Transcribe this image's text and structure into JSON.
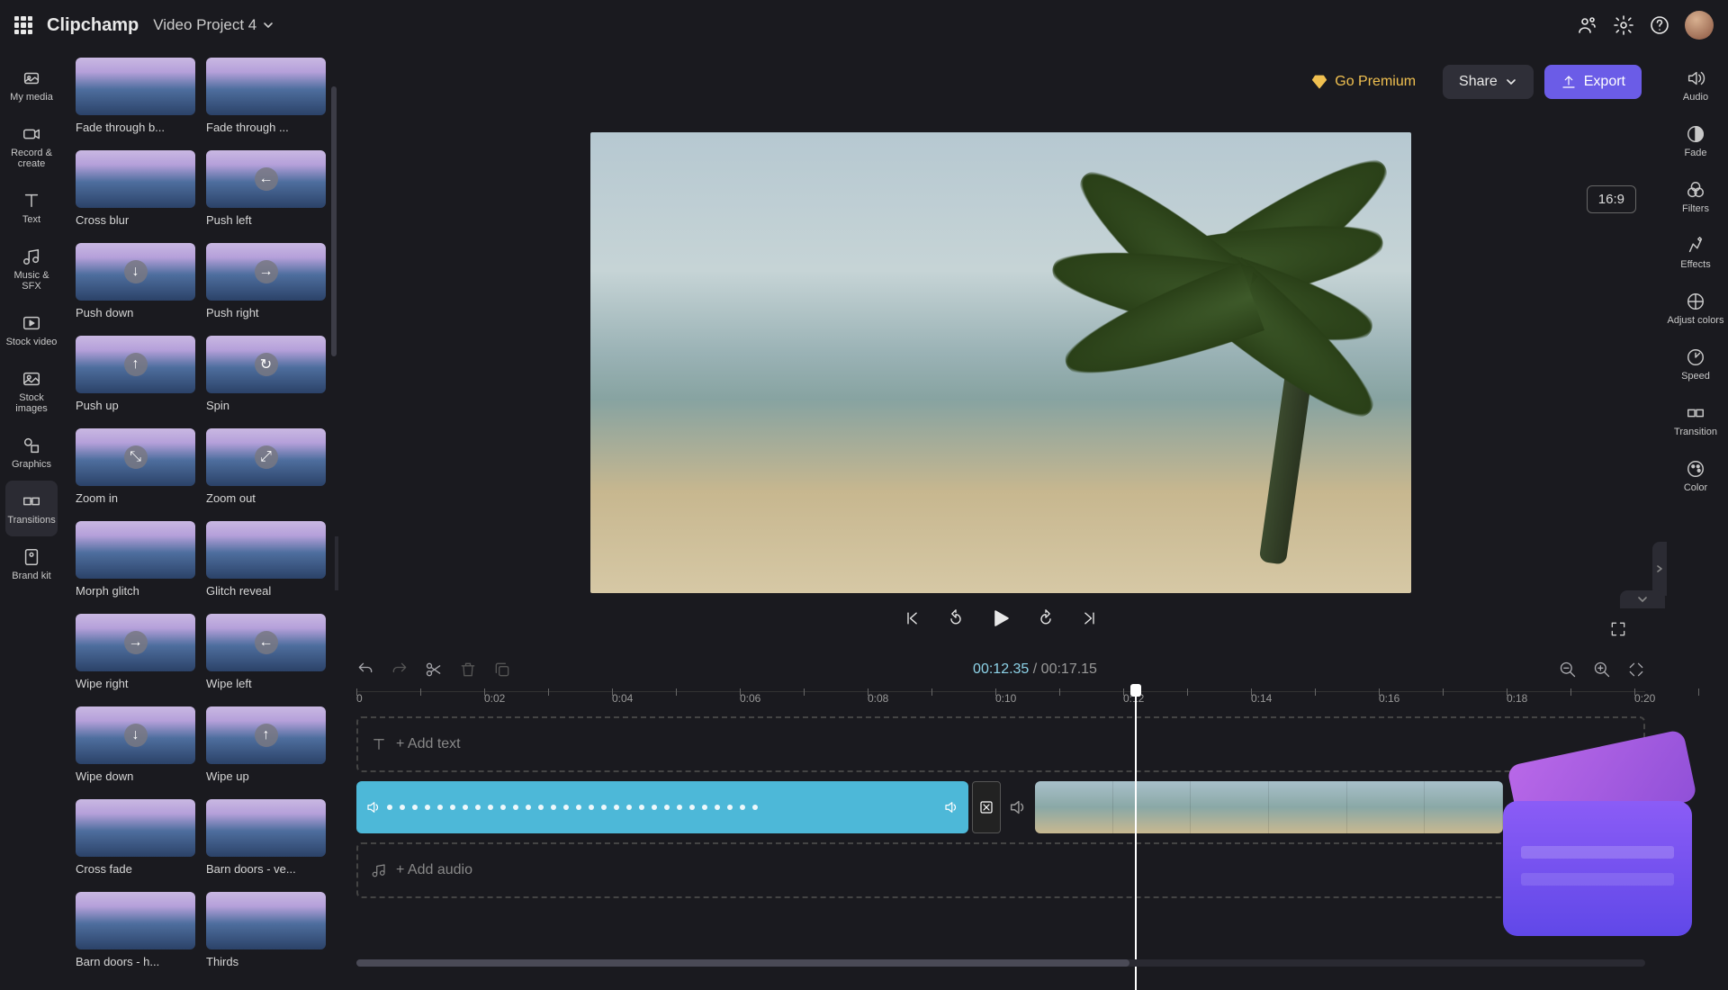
{
  "brand": "Clipchamp",
  "project_name": "Video Project 4",
  "topbar": {
    "premium_label": "Go Premium",
    "share_label": "Share",
    "export_label": "Export"
  },
  "leftbar": [
    {
      "id": "my-media",
      "label": "My media"
    },
    {
      "id": "record-create",
      "label": "Record & create"
    },
    {
      "id": "text",
      "label": "Text"
    },
    {
      "id": "music-sfx",
      "label": "Music & SFX"
    },
    {
      "id": "stock-video",
      "label": "Stock video"
    },
    {
      "id": "stock-images",
      "label": "Stock images"
    },
    {
      "id": "graphics",
      "label": "Graphics"
    },
    {
      "id": "transitions",
      "label": "Transitions"
    },
    {
      "id": "brand-kit",
      "label": "Brand kit"
    }
  ],
  "transitions": [
    {
      "label": "Fade through b...",
      "icon": ""
    },
    {
      "label": "Fade through ...",
      "icon": ""
    },
    {
      "label": "Cross blur",
      "icon": ""
    },
    {
      "label": "Push left",
      "icon": "←"
    },
    {
      "label": "Push down",
      "icon": "↓"
    },
    {
      "label": "Push right",
      "icon": "→"
    },
    {
      "label": "Push up",
      "icon": "↑"
    },
    {
      "label": "Spin",
      "icon": "↻"
    },
    {
      "label": "Zoom in",
      "icon": "⤡"
    },
    {
      "label": "Zoom out",
      "icon": "⤢"
    },
    {
      "label": "Morph glitch",
      "icon": ""
    },
    {
      "label": "Glitch reveal",
      "icon": ""
    },
    {
      "label": "Wipe right",
      "icon": "→"
    },
    {
      "label": "Wipe left",
      "icon": "←"
    },
    {
      "label": "Wipe down",
      "icon": "↓"
    },
    {
      "label": "Wipe up",
      "icon": "↑"
    },
    {
      "label": "Cross fade",
      "icon": ""
    },
    {
      "label": "Barn doors - ve...",
      "icon": ""
    },
    {
      "label": "Barn doors - h...",
      "icon": ""
    },
    {
      "label": "Thirds",
      "icon": ""
    }
  ],
  "rightbar": [
    {
      "id": "audio",
      "label": "Audio"
    },
    {
      "id": "fade",
      "label": "Fade"
    },
    {
      "id": "filters",
      "label": "Filters"
    },
    {
      "id": "effects",
      "label": "Effects"
    },
    {
      "id": "adjust-colors",
      "label": "Adjust colors"
    },
    {
      "id": "speed",
      "label": "Speed"
    },
    {
      "id": "transition",
      "label": "Transition"
    },
    {
      "id": "color",
      "label": "Color"
    }
  ],
  "aspect_ratio": "16:9",
  "time": {
    "current": "00:12.35",
    "total": "00:17.15",
    "sep": " / "
  },
  "ruler": [
    "0",
    "0:02",
    "0:04",
    "0:06",
    "0:08",
    "0:10",
    "0:12",
    "0:14",
    "0:16",
    "0:18",
    "0:20"
  ],
  "tracks": {
    "text_placeholder": "+ Add text",
    "audio_placeholder": "+ Add audio"
  }
}
